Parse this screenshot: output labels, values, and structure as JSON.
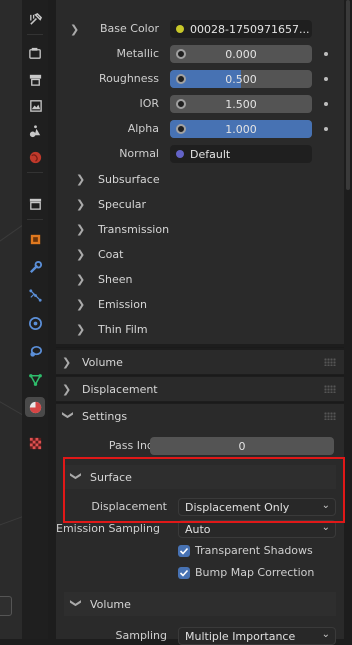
{
  "tabs": [
    {
      "name": "tool-tab-icon",
      "active": false
    },
    {
      "name": "render-tab-icon",
      "active": false
    },
    {
      "name": "output-tab-icon",
      "active": false
    },
    {
      "name": "view-layer-tab-icon",
      "active": false
    },
    {
      "name": "scene-tab-icon",
      "active": false
    },
    {
      "name": "world-tab-icon",
      "active": false
    },
    {
      "name": "collection-tab-icon",
      "active": false
    },
    {
      "name": "object-tab-icon",
      "active": false
    },
    {
      "name": "modifier-tab-icon",
      "active": false
    },
    {
      "name": "particles-tab-icon",
      "active": false
    },
    {
      "name": "physics-tab-icon",
      "active": false
    },
    {
      "name": "constraints-tab-icon",
      "active": false
    },
    {
      "name": "data-tab-icon",
      "active": false
    },
    {
      "name": "material-tab-icon",
      "active": true
    },
    {
      "name": "texture-tab-icon",
      "active": false
    }
  ],
  "principled": {
    "base_color": {
      "label": "Base Color",
      "value": "00028-1750971657..."
    },
    "metallic": {
      "label": "Metallic",
      "value": "0.000",
      "fill": 0.0
    },
    "roughness": {
      "label": "Roughness",
      "value": "0.500",
      "fill": 0.5
    },
    "ior": {
      "label": "IOR",
      "value": "1.500",
      "fill": 0.0
    },
    "alpha": {
      "label": "Alpha",
      "value": "1.000",
      "fill": 1.0
    },
    "normal": {
      "label": "Normal",
      "value": "Default"
    }
  },
  "subpanels": [
    "Subsurface",
    "Specular",
    "Transmission",
    "Coat",
    "Sheen",
    "Emission",
    "Thin Film"
  ],
  "panels": {
    "volume": "Volume",
    "displacement": "Displacement",
    "settings": "Settings"
  },
  "settings": {
    "pass_index_label": "Pass Index",
    "pass_index_value": "0",
    "surface_header": "Surface",
    "displacement_label": "Displacement",
    "displacement_value": "Displacement Only",
    "emission_sampling_label": "Emission Sampling",
    "emission_sampling_value": "Auto",
    "transparent_shadows_label": "Transparent Shadows",
    "transparent_shadows_checked": true,
    "bump_map_label": "Bump Map Correction",
    "bump_map_checked": true,
    "volume_header": "Volume",
    "sampling_label": "Sampling",
    "sampling_value": "Multiple Importance"
  },
  "colors": {
    "accent": "#4772b3",
    "highlight": "#e01818",
    "socket_yellow": "#c7c729",
    "socket_gray": "#a1a1a1",
    "socket_blue": "#6363c7"
  }
}
